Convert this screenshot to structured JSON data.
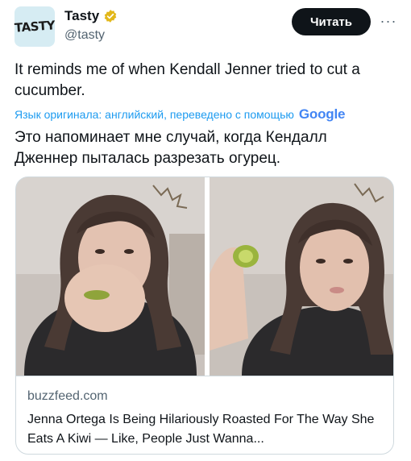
{
  "account": {
    "avatar_text": "TASTY",
    "name": "Tasty",
    "handle": "@tasty",
    "verified_color": "#e2b719"
  },
  "follow_label": "Читать",
  "more_label": "···",
  "tweet": {
    "text": "It reminds me of when Kendall Jenner tried to cut a cucumber.",
    "translation_note": "Язык оригинала: английский, переведено с помощью",
    "translation_provider": "Google",
    "translated_text": "Это напоминает мне случай, когда Кендалл Дженнер пыталась разрезать огурец."
  },
  "card": {
    "domain": "buzzfeed.com",
    "headline": "Jenna Ortega Is Being Hilariously Roasted For The Way She Eats A Kiwi — Like, People Just Wanna..."
  },
  "colors": {
    "text": "#0f1419",
    "secondary": "#536471",
    "link": "#1d9bf0",
    "border": "#cfd9de"
  }
}
